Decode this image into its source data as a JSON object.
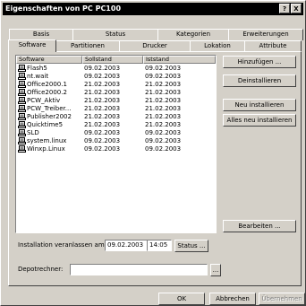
{
  "window": {
    "title": "Eigenschaften von PC PC100",
    "help_label": "?",
    "close_label": "X"
  },
  "tabs_row1": [
    {
      "label": "Basis"
    },
    {
      "label": "Status"
    },
    {
      "label": "Kategorien"
    },
    {
      "label": "Erweiterungen"
    }
  ],
  "tabs_row2": [
    {
      "label": "Software"
    },
    {
      "label": "Partitionen"
    },
    {
      "label": "Drucker"
    },
    {
      "label": "Lokation"
    },
    {
      "label": "Attribute"
    }
  ],
  "list": {
    "columns": [
      "Software",
      "Sollstand",
      "Iststand"
    ],
    "rows": [
      {
        "name": "Flash5",
        "soll": "09.02.2003",
        "ist": "09.02.2003"
      },
      {
        "name": "nt.wait",
        "soll": "09.02.2003",
        "ist": "09.02.2003"
      },
      {
        "name": "Office2000.1",
        "soll": "21.02.2003",
        "ist": "21.02.2003"
      },
      {
        "name": "Office2000.2",
        "soll": "21.02.2003",
        "ist": "21.02.2003"
      },
      {
        "name": "PCW_Aktiv",
        "soll": "21.02.2003",
        "ist": "21.02.2003"
      },
      {
        "name": "PCW_Treiber...",
        "soll": "21.02.2003",
        "ist": "21.02.2003"
      },
      {
        "name": "Publisher2002",
        "soll": "21.02.2003",
        "ist": "21.02.2003"
      },
      {
        "name": "Quicktime5",
        "soll": "21.02.2003",
        "ist": "21.02.2003"
      },
      {
        "name": "SLD",
        "soll": "09.02.2003",
        "ist": "09.02.2003"
      },
      {
        "name": "system.linux",
        "soll": "09.02.2003",
        "ist": "09.02.2003"
      },
      {
        "name": "Winxp.Linux",
        "soll": "09.02.2003",
        "ist": "09.02.2003"
      }
    ]
  },
  "side_buttons": {
    "hinzufuegen": "Hinzufügen ...",
    "deinstallieren": "Deinstallieren",
    "neu_installieren": "Neu installieren",
    "alles_neu": "Alles neu installieren",
    "bearbeiten": "Bearbeiten ..."
  },
  "installation": {
    "label": "Installation veranlassen am:",
    "date": "09.02.2003",
    "time": "14:05",
    "status_button": "Status ..."
  },
  "depot": {
    "label": "Depotrechner:",
    "value": "",
    "browse_button": "..."
  },
  "footer": {
    "ok": "OK",
    "cancel": "Abbrechen",
    "apply": "Übernehmen"
  }
}
